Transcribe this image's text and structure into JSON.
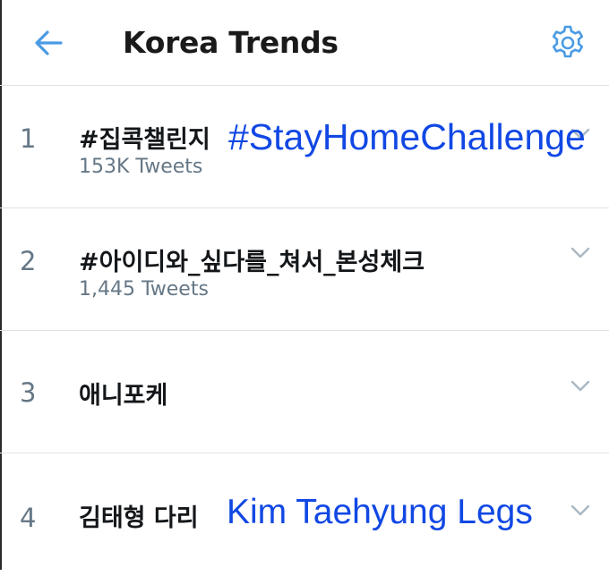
{
  "header": {
    "title": "Korea Trends",
    "back_icon": "arrow-left-icon",
    "settings_icon": "gear-icon",
    "accent_color": "#4a9be3"
  },
  "trends": [
    {
      "rank": "1",
      "name": "#집콕챌린지",
      "tweets": "153K Tweets"
    },
    {
      "rank": "2",
      "name": "#아이디와_싶다를_쳐서_본성체크",
      "tweets": "1,445 Tweets"
    },
    {
      "rank": "3",
      "name": "애니포케",
      "tweets": ""
    },
    {
      "rank": "4",
      "name": "김태형 다리",
      "tweets": ""
    }
  ],
  "annotations": {
    "trend1_translation": "#StayHomeChallenge",
    "trend4_translation": "Kim Taehyung Legs",
    "color": "#1148e4"
  },
  "chevron_icon": "chevron-down-icon"
}
